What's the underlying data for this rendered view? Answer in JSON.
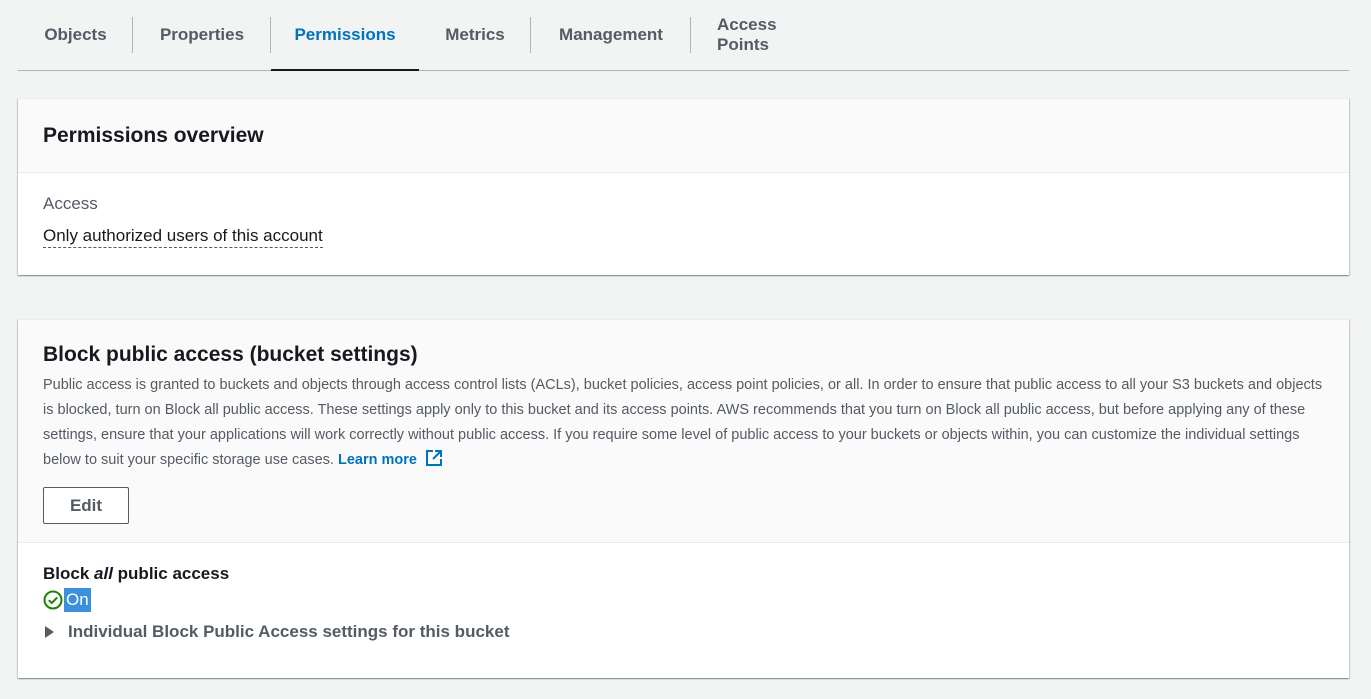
{
  "tabs": [
    {
      "label": "Objects",
      "active": false
    },
    {
      "label": "Properties",
      "active": false
    },
    {
      "label": "Permissions",
      "active": true
    },
    {
      "label": "Metrics",
      "active": false
    },
    {
      "label": "Management",
      "active": false
    },
    {
      "label": "Access Points",
      "active": false
    }
  ],
  "overview": {
    "title": "Permissions overview",
    "access_label": "Access",
    "access_value": "Only authorized users of this account"
  },
  "block_public_access": {
    "title": "Block public access (bucket settings)",
    "description": "Public access is granted to buckets and objects through access control lists (ACLs), bucket policies, access point policies, or all. In order to ensure that public access to all your S3 buckets and objects is blocked, turn on Block all public access. These settings apply only to this bucket and its access points. AWS recommends that you turn on Block all public access, but before applying any of these settings, ensure that your applications will work correctly without public access. If you require some level of public access to your buckets or objects within, you can customize the individual settings below to suit your specific storage use cases.",
    "learn_more": "Learn more",
    "edit_label": "Edit",
    "block_all_prefix": "Block ",
    "block_all_emphasis": "all",
    "block_all_suffix": " public access",
    "status": "On",
    "individual_settings_label": "Individual Block Public Access settings for this bucket"
  },
  "colors": {
    "accent": "#0073bb",
    "success": "#1d8102",
    "selection": "#3b8fdb"
  },
  "icons": {
    "external_link": "external-link-icon",
    "status": "check-circle-icon",
    "expander": "caret-right-icon"
  }
}
